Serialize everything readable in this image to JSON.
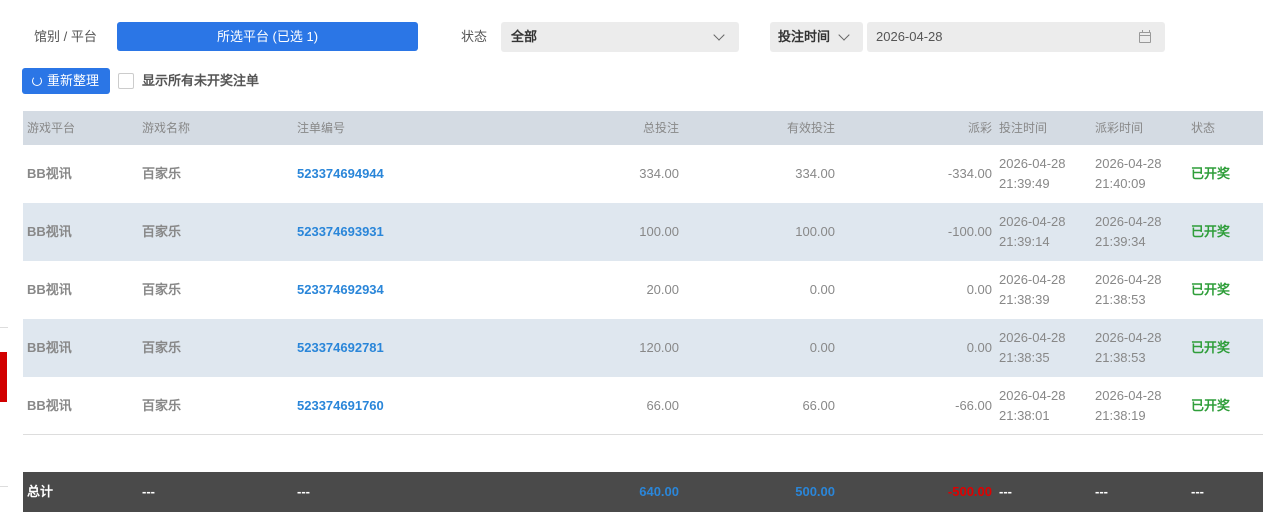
{
  "filters": {
    "venue_label": "馆别 / 平台",
    "platform_button": "所选平台 (已选 1)",
    "status_label": "状态",
    "status_value": "全部",
    "time_type": "投注时间",
    "date_value": "2026-04-28"
  },
  "actions": {
    "refresh_label": "重新整理",
    "show_unsettled_label": "显示所有未开奖注单"
  },
  "table": {
    "headers": [
      "游戏平台",
      "游戏名称",
      "注单编号",
      "总投注",
      "有效投注",
      "派彩",
      "投注时间",
      "派彩时间",
      "状态"
    ],
    "rows": [
      {
        "platform": "BB视讯",
        "game": "百家乐",
        "id": "523374694944",
        "total": "334.00",
        "valid": "334.00",
        "payout": "-334.00",
        "bet_date": "2026-04-28",
        "bet_time": "21:39:49",
        "pay_date": "2026-04-28",
        "pay_time": "21:40:09",
        "status": "已开奖"
      },
      {
        "platform": "BB视讯",
        "game": "百家乐",
        "id": "523374693931",
        "total": "100.00",
        "valid": "100.00",
        "payout": "-100.00",
        "bet_date": "2026-04-28",
        "bet_time": "21:39:14",
        "pay_date": "2026-04-28",
        "pay_time": "21:39:34",
        "status": "已开奖"
      },
      {
        "platform": "BB视讯",
        "game": "百家乐",
        "id": "523374692934",
        "total": "20.00",
        "valid": "0.00",
        "payout": "0.00",
        "bet_date": "2026-04-28",
        "bet_time": "21:38:39",
        "pay_date": "2026-04-28",
        "pay_time": "21:38:53",
        "status": "已开奖"
      },
      {
        "platform": "BB视讯",
        "game": "百家乐",
        "id": "523374692781",
        "total": "120.00",
        "valid": "0.00",
        "payout": "0.00",
        "bet_date": "2026-04-28",
        "bet_time": "21:38:35",
        "pay_date": "2026-04-28",
        "pay_time": "21:38:53",
        "status": "已开奖"
      },
      {
        "platform": "BB视讯",
        "game": "百家乐",
        "id": "523374691760",
        "total": "66.00",
        "valid": "66.00",
        "payout": "-66.00",
        "bet_date": "2026-04-28",
        "bet_time": "21:38:01",
        "pay_date": "2026-04-28",
        "pay_time": "21:38:19",
        "status": "已开奖"
      }
    ]
  },
  "totals": {
    "label": "总计",
    "game": "---",
    "id": "---",
    "total": "640.00",
    "valid": "500.00",
    "payout": "-500.00",
    "bet_time": "---",
    "pay_time": "---",
    "status": "---"
  },
  "colors": {
    "accent": "#2b76e6",
    "link": "#2a86d9",
    "settled": "#2f9e3a",
    "negative_total": "#e00000"
  }
}
